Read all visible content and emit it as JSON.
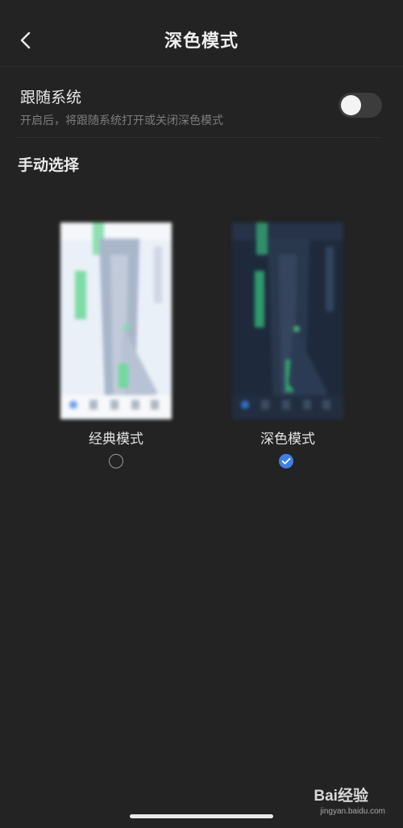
{
  "header": {
    "title": "深色模式",
    "back_icon": "chevron-left-icon"
  },
  "follow_system": {
    "title": "跟随系统",
    "description": "开启后，将跟随系统打开或关闭深色模式",
    "toggle_on": false
  },
  "manual": {
    "section_title": "手动选择",
    "options": [
      {
        "label": "经典模式",
        "selected": false
      },
      {
        "label": "深色模式",
        "selected": true
      }
    ]
  },
  "watermark": {
    "brand": "Bai经验",
    "site": "jingyan.baidu.com"
  },
  "colors": {
    "background": "#232323",
    "accent": "#3d7fe8",
    "text_primary": "#e8e8e8",
    "text_secondary": "#7d7d7d"
  }
}
